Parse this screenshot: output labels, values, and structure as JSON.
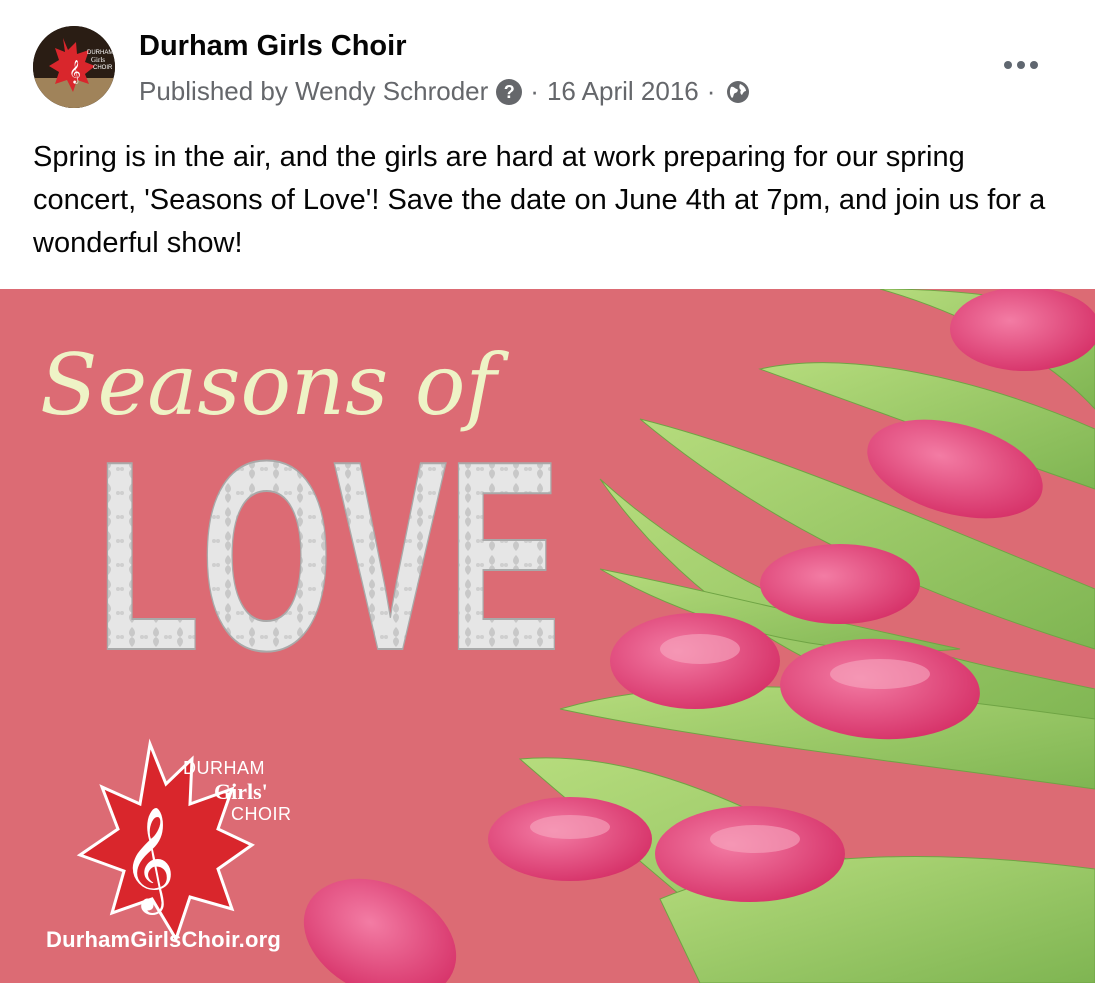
{
  "post": {
    "page_name": "Durham Girls Choir",
    "published_by": "Published by Wendy Schroder",
    "help_icon": "?",
    "separator": "·",
    "date": "16 April 2016",
    "audience_icon": "globe-icon",
    "more_icon": "more-options-icon",
    "text": "Spring is in the air, and the girls are hard at work preparing for our spring concert, 'Seasons of Love'! Save the date on June 4th at 7pm, and join us for a wonderful show!"
  },
  "poster": {
    "script_title": "Seasons of",
    "block_title": "LOVE",
    "logo_line1": "DURHAM",
    "logo_line2": "Girls'",
    "logo_line3": "CHOIR",
    "website": "DurhamGirlsChoir.org"
  },
  "colors": {
    "background_pink": "#d9646d",
    "leaf_green": "#8fc463",
    "tulip_pink": "#e8407a",
    "logo_red": "#d9262c",
    "title_cream": "#eef3c6"
  }
}
